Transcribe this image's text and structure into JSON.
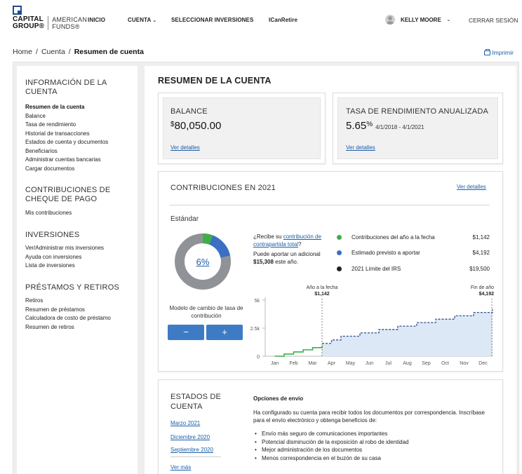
{
  "logo": {
    "left_top": "CAPITAL",
    "left_bottom": "GROUP®",
    "right_top": "AMERICAN",
    "right_bottom": "FUNDS®"
  },
  "nav": {
    "inicio": "INICIO",
    "cuenta": "CUENTA",
    "seleccionar": "SELECCIONAR INVERSIONES",
    "icanretire": "ICanRetire"
  },
  "user": {
    "name": "KELLY MOORE",
    "logout": "CERRAR SESIÓN"
  },
  "breadcrumb": {
    "home": "Home",
    "cuenta": "Cuenta",
    "current": "Resumen de cuenta"
  },
  "print_label": "Imprimir",
  "sidebar": {
    "sections": [
      {
        "heading_line1": "INFORMACIÓN DE LA",
        "heading_line2": "CUENTA",
        "items": [
          "Resumen de la cuenta",
          "Balance",
          "Tasa de rendimiento",
          "Historial de transacciones",
          "Estados de cuenta y documentos",
          "Beneficiarios",
          "Administrar cuentas bancarias",
          "Cargar documentos"
        ]
      },
      {
        "heading_line1": "CONTRIBUCIONES DE",
        "heading_line2": "CHEQUE DE PAGO",
        "items": [
          "Mis contribuciones"
        ]
      },
      {
        "heading_line1": "INVERSIONES",
        "heading_line2": "",
        "items": [
          "Ver/Administrar mis inversiones",
          "Ayuda con inversiones",
          "Lista de inversiones"
        ]
      },
      {
        "heading_line1": "PRÉSTAMOS Y RETIROS",
        "heading_line2": "",
        "items": [
          "Retiros",
          "Resumen de préstamos",
          "Calculadora de costo de préstamo",
          "Resumen de retiros"
        ]
      }
    ]
  },
  "page_title": "RESUMEN DE LA CUENTA",
  "balance": {
    "label": "BALANCE",
    "currency": "$",
    "amount": "80,050.00",
    "link": "Ver detalles"
  },
  "rate": {
    "label": "TASA DE RENDIMIENTO ANUALIZADA",
    "value": "5.65",
    "unit": "%",
    "range": "4/1/2018 - 4/1/2021",
    "link": "Ver detalles"
  },
  "contributions": {
    "title": "CONTRIBUCIONES EN 2021",
    "link": "Ver detalles",
    "standard_label": "Estándar",
    "percent": "6%",
    "rate_label": "Modelo de cambio de tasa de contribución",
    "minus": "−",
    "plus": "+",
    "promo_prefix": "¿Recibe su ",
    "promo_link": "contribución de contrapartida total",
    "promo_suffix": "?",
    "promo_line2_prefix": "Puede aportar un adicional ",
    "promo_amount": "$15,308",
    "promo_line2_suffix": " este año.",
    "legend": [
      {
        "name": "Contribuciones del año a la fecha",
        "value": "$1,142",
        "color": "#3fae49"
      },
      {
        "name": "Estimado previsto a aportar",
        "value": "$4,192",
        "color": "#3a6fc4"
      },
      {
        "name": "2021 Límite del IRS",
        "value": "$19,500",
        "color": "#222222"
      }
    ],
    "colors": {
      "ytd": "#3fae49",
      "projected": "#3a6fc4",
      "irs": "#8f9398"
    },
    "donut_fractions": {
      "ytd": 0.0586,
      "projected": 0.1564
    }
  },
  "chart_data": {
    "type": "line",
    "categories": [
      "Jan",
      "Feb",
      "Mar",
      "Apr",
      "May",
      "Jun",
      "Jul",
      "Aug",
      "Sep",
      "Oct",
      "Nov",
      "Dec"
    ],
    "y_ticks": [
      "0",
      "2.5k",
      "5k"
    ],
    "ylim": [
      0,
      5000
    ],
    "series": [
      {
        "name": "Contribuciones del año a la fecha",
        "style": "solid",
        "x": [
          0,
          0.5,
          1,
          1.5,
          2,
          2.5
        ],
        "y": [
          0,
          190,
          380,
          570,
          760,
          950
        ]
      },
      {
        "name": "Estimado previsto a aportar",
        "style": "dashed",
        "x": [
          2.5,
          3,
          3.5,
          4,
          4.5,
          5,
          5.5,
          6,
          6.5,
          7,
          7.5,
          8,
          8.5,
          9,
          9.5,
          10,
          10.5,
          11,
          11.5
        ],
        "y": [
          1142,
          1450,
          1780,
          1780,
          2080,
          2080,
          2380,
          2380,
          2680,
          2680,
          3000,
          3000,
          3300,
          3300,
          3600,
          3600,
          3900,
          3900,
          4192
        ]
      }
    ],
    "markers": [
      {
        "label": "Año a la fecha",
        "value_label": "$1,142",
        "x": 2.5
      },
      {
        "label": "Fin de año",
        "value_label": "$4,192",
        "x": 11.5
      }
    ]
  },
  "statements": {
    "title_line1": "ESTADOS DE",
    "title_line2": "CUENTA",
    "links": [
      "Marzo 2021",
      "Diciembre 2020",
      "Septiembre 2020"
    ],
    "more": "Ver más",
    "options_title": "Opciones de envío",
    "options_text": "Ha configurado su cuenta para recibir todos los documentos por correspondencia. Inscríbase para el envío electrónico y obtenga beneficios de:",
    "benefits": [
      "Envío más seguro de comunicaciones importantes",
      "Potencial disminución de la exposición al robo de identidad",
      "Mejor administración de los documentos",
      "Menos correspondencia en el buzón de su casa"
    ]
  }
}
